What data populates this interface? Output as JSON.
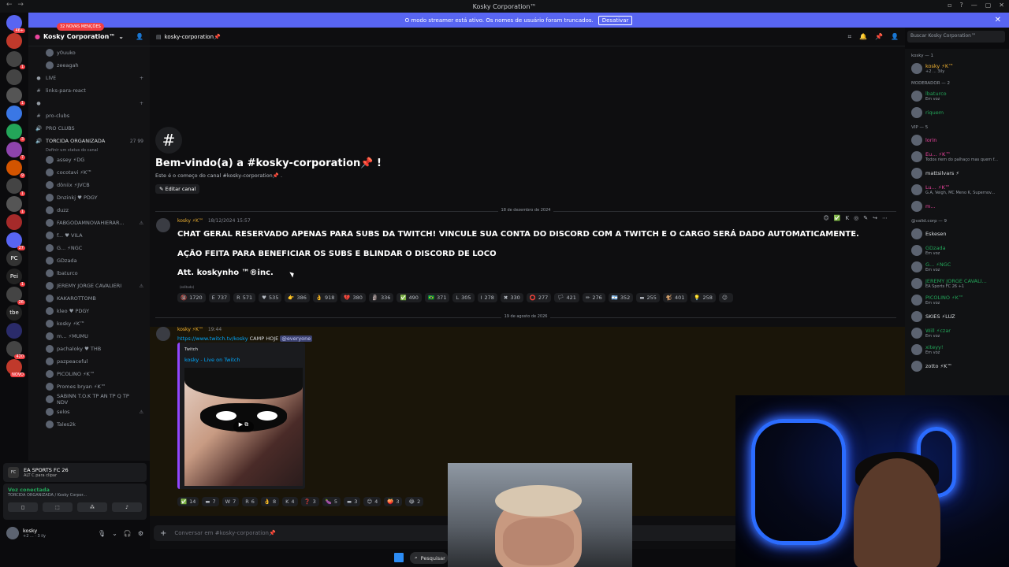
{
  "window": {
    "title": "Kosky Corporation™",
    "win_controls": [
      "▫",
      "?",
      "—",
      "▢",
      "✕"
    ]
  },
  "banner": {
    "text": "O modo streamer está ativo. Os nomes de usuário foram truncados.",
    "button": "Desativar",
    "close": "✕"
  },
  "server_rail": {
    "items": [
      {
        "label": "",
        "color": "#5865f2",
        "badge": "46+"
      },
      {
        "label": "",
        "color": "#c0392b",
        "badge": ""
      },
      {
        "label": "",
        "color": "#444",
        "badge": "1"
      },
      {
        "label": "",
        "color": "#444",
        "badge": ""
      },
      {
        "label": "",
        "color": "#555",
        "badge": "1"
      },
      {
        "label": "",
        "color": "#3a77e5",
        "badge": ""
      },
      {
        "label": "",
        "color": "#23a559",
        "badge": "3"
      },
      {
        "label": "",
        "color": "#8e44ad",
        "badge": "7"
      },
      {
        "label": "",
        "color": "#d35400",
        "badge": "9"
      },
      {
        "label": "",
        "color": "#444",
        "badge": "1"
      },
      {
        "label": "",
        "color": "#555",
        "badge": "1"
      },
      {
        "label": "",
        "color": "#a52a2a",
        "badge": ""
      },
      {
        "label": "",
        "color": "#5865f2",
        "badge": "27"
      },
      {
        "label": "PC",
        "color": "#333",
        "badge": ""
      },
      {
        "label": "Pei",
        "color": "#222",
        "badge": "1"
      },
      {
        "label": "",
        "color": "#444",
        "badge": "26"
      },
      {
        "label": "tbe",
        "color": "#222",
        "badge": ""
      },
      {
        "label": "",
        "color": "#2a2b6a",
        "badge": ""
      },
      {
        "label": "",
        "color": "#444",
        "badge": "420"
      },
      {
        "label": "",
        "color": "#c0392b",
        "badge": "NOVO"
      }
    ]
  },
  "guild": {
    "name": "Kosky Corporation™",
    "mentions_pill": "32 NOVAS MENÇÕES"
  },
  "channel_list": [
    {
      "type": "voice-user",
      "text": "y0uuko",
      "tail": ""
    },
    {
      "type": "voice-user",
      "text": "zeeagah",
      "tail": ""
    },
    {
      "type": "cat",
      "text": "LIVE",
      "tail": "+"
    },
    {
      "type": "channel",
      "text": "links-para-react",
      "tail": ""
    },
    {
      "type": "cat",
      "text": "",
      "tail": "+"
    },
    {
      "type": "channel",
      "text": "pro-clubs",
      "tail": ""
    },
    {
      "type": "voice",
      "text": "PRO CLUBS",
      "tail": ""
    },
    {
      "type": "voice-white",
      "text": "TORCIDA ORGANIZADA",
      "tail": "27 99"
    },
    {
      "type": "sub",
      "text": "Definir um status do canal"
    },
    {
      "type": "voice-user",
      "text": "assey  ⚡DG",
      "tail": ""
    },
    {
      "type": "voice-user",
      "text": "cocotavi ⚡K™",
      "tail": ""
    },
    {
      "type": "voice-user",
      "text": "dôniix  ⚡JVCB",
      "tail": ""
    },
    {
      "type": "voice-user",
      "text": "Dnzinkj ♥ PDGY",
      "tail": ""
    },
    {
      "type": "voice-user",
      "text": "duzz",
      "tail": ""
    },
    {
      "type": "voice-user",
      "text": "FABGODAMNOVAHIERAR...",
      "tail": "⚠"
    },
    {
      "type": "voice-user",
      "text": "f... ♥ VILA",
      "tail": ""
    },
    {
      "type": "voice-user",
      "text": "G... ⚡NGC",
      "tail": ""
    },
    {
      "type": "voice-user",
      "text": "GDzada",
      "tail": ""
    },
    {
      "type": "voice-user",
      "text": "lbaturco",
      "tail": ""
    },
    {
      "type": "voice-user",
      "text": "JEREMY JORGE CAVALIERI",
      "tail": "⚠"
    },
    {
      "type": "voice-user",
      "text": "KAKAROTTOMB",
      "tail": ""
    },
    {
      "type": "voice-user",
      "text": "kleo ♥ PDGY",
      "tail": ""
    },
    {
      "type": "voice-user",
      "text": "kosky ⚡K™",
      "tail": ""
    },
    {
      "type": "voice-user",
      "text": "m... ⚡MUMU",
      "tail": ""
    },
    {
      "type": "voice-user",
      "text": "pachaloky ♥ THB",
      "tail": ""
    },
    {
      "type": "voice-user",
      "text": "pazpeaceful",
      "tail": ""
    },
    {
      "type": "voice-user",
      "text": "PICOLINO ⚡K™",
      "tail": ""
    },
    {
      "type": "voice-user",
      "text": "Promes bryan ⚡K™",
      "tail": ""
    },
    {
      "type": "voice-user",
      "text": "SABINN T.O.K TP AN TP Q TP NDV",
      "tail": ""
    },
    {
      "type": "voice-user",
      "text": "selos",
      "tail": "⚠"
    },
    {
      "type": "voice-user",
      "text": "Tales2k",
      "tail": ""
    }
  ],
  "game_activity": {
    "name": "EA SPORTS FC 26",
    "sub": "ALT  C  para clipar"
  },
  "voice_status": {
    "title": "Voz conectada",
    "sub": "TORCIDA ORGANIZADA / Kosky Corpor...",
    "buttons": [
      "◻",
      "⬚",
      "⁂",
      "♪"
    ]
  },
  "user_panel": {
    "name": "kosky",
    "sub": "+2 ... · 3 ily",
    "controls": [
      "🎙",
      "⌄",
      "🎧",
      "⚙"
    ]
  },
  "channel_header": {
    "name": "kosky-corporation📌",
    "icons": [
      "⌗",
      "🔔",
      "📌",
      "👤"
    ],
    "search_placeholder": "Buscar Kosky Corporation™"
  },
  "welcome": {
    "title": "Bem-vindo(a) a #kosky-corporation📌 !",
    "sub": "Este é o começo do canal #kosky-corporation📌 .",
    "edit_button": "Editar canal"
  },
  "dividers": {
    "first": "18 de dezembro de 2024",
    "second": "19 de agosto de 2026"
  },
  "message1": {
    "author": "kosky ⚡K™",
    "timestamp": "18/12/2024 15:57",
    "lines": [
      "CHAT GERAL RESERVADO APENAS PARA SUBS DA TWITCH! VINCULE SUA CONTA DO DISCORD COM A TWITCH E O CARGO SERÁ DADO AUTOMATICAMENTE.",
      "AÇÃO FEITA PARA BENEFICIAR OS SUBS E BLINDAR O DISCORD DE LOCO",
      "Att. koskynho ™®inc."
    ],
    "edited": "(editado)",
    "reactions": [
      {
        "emoji": "🔞",
        "count": "1720"
      },
      {
        "emoji": "E",
        "count": "737"
      },
      {
        "emoji": "R",
        "count": "571"
      },
      {
        "emoji": "♥",
        "count": "535"
      },
      {
        "emoji": "👉",
        "count": "386"
      },
      {
        "emoji": "👌",
        "count": "918"
      },
      {
        "emoji": "💔",
        "count": "380"
      },
      {
        "emoji": "🗿",
        "count": "336"
      },
      {
        "emoji": "✅",
        "count": "490"
      },
      {
        "emoji": "🇧🇷",
        "count": "371"
      },
      {
        "emoji": "L",
        "count": "305"
      },
      {
        "emoji": "I",
        "count": "278"
      },
      {
        "emoji": "✖",
        "count": "330"
      },
      {
        "emoji": "⭕",
        "count": "277"
      },
      {
        "emoji": "🏳",
        "count": "421"
      },
      {
        "emoji": "✏",
        "count": "276"
      },
      {
        "emoji": "🇦🇷",
        "count": "352"
      },
      {
        "emoji": "▬",
        "count": "255"
      },
      {
        "emoji": "🐒",
        "count": "401"
      },
      {
        "emoji": "💡",
        "count": "258"
      },
      {
        "emoji": "☺",
        "count": ""
      }
    ],
    "actions": [
      "😊",
      "✅",
      "K",
      "◎",
      "✎",
      "↪",
      "⋯"
    ]
  },
  "message2": {
    "author": "kosky ⚡K™",
    "timestamp": "19:44",
    "link": "https://www.twitch.tv/kosky",
    "text": " CAMP HOJE ",
    "mention": "@everyone",
    "embed": {
      "provider": "Twitch",
      "title": "kosky - Live on Twitch",
      "play": "▶ ⧉"
    },
    "reactions": [
      {
        "emoji": "✅",
        "count": "14"
      },
      {
        "emoji": "▬",
        "count": "7"
      },
      {
        "emoji": "W",
        "count": "7"
      },
      {
        "emoji": "R",
        "count": "6"
      },
      {
        "emoji": "👌",
        "count": "8"
      },
      {
        "emoji": "K",
        "count": "4"
      },
      {
        "emoji": "❓",
        "count": "3"
      },
      {
        "emoji": "🍆",
        "count": "5"
      },
      {
        "emoji": "▬",
        "count": "3"
      },
      {
        "emoji": "😊",
        "count": "4"
      },
      {
        "emoji": "🍑",
        "count": "3"
      },
      {
        "emoji": "😂",
        "count": "2"
      }
    ]
  },
  "composer": {
    "placeholder": "Conversar em #kosky-corporation📌",
    "plus": "+"
  },
  "members": {
    "groups": [
      {
        "title": "kosky — 1",
        "people": [
          {
            "name": "kosky ⚡K™",
            "status": "+2 ... 3ily",
            "color": "#f0b232"
          }
        ]
      },
      {
        "title": "MODERADOR — 2",
        "people": [
          {
            "name": "lbaturco",
            "status": "Em voz",
            "color": "#23a559"
          },
          {
            "name": "riquem",
            "status": "",
            "color": "#23a559"
          }
        ]
      },
      {
        "title": "VIP — 5",
        "people": [
          {
            "name": "lorin",
            "status": "",
            "color": "#eb459e"
          },
          {
            "name": "Eu... ⚡K™",
            "status": "Todos riem do palhaço mas quem f...",
            "color": "#eb459e"
          },
          {
            "name": "mattsilvars ⚡",
            "status": "",
            "color": "#dbdee1"
          },
          {
            "name": "Lu... ⚡K™",
            "status": "G.A, Veigh, MC Meno K, Supernov...",
            "color": "#eb459e"
          },
          {
            "name": "m...",
            "status": "",
            "color": "#eb459e"
          }
        ]
      },
      {
        "title": "@valid.corp — 9",
        "people": [
          {
            "name": "Eskesen",
            "status": "",
            "color": "#dbdee1"
          },
          {
            "name": "GDzada",
            "status": "Em voz",
            "color": "#23a559"
          },
          {
            "name": "G... ⚡NGC",
            "status": "Em voz",
            "color": "#23a559"
          },
          {
            "name": "JEREMY JORGE CAVALI...",
            "status": "EA Sports FC 26 +1",
            "color": "#23a559"
          },
          {
            "name": "PICOLINO ⚡K™",
            "status": "Em voz",
            "color": "#23a559"
          },
          {
            "name": "SKIES ⚡LUZ",
            "status": "",
            "color": "#dbdee1"
          },
          {
            "name": "Will ⚡czar",
            "status": "Em voz",
            "color": "#23a559"
          },
          {
            "name": "xiteyy!",
            "status": "Em voz",
            "color": "#23a559"
          },
          {
            "name": "zotto ⚡K™",
            "status": "",
            "color": "#dbdee1"
          }
        ]
      }
    ]
  },
  "taskbar": {
    "search": "Pesquisar"
  },
  "colors": {
    "accent": "#5865f2",
    "twitch": "#9146ff",
    "link": "#00a8fc",
    "online": "#23a559",
    "mention_bg": "#3c4270"
  }
}
